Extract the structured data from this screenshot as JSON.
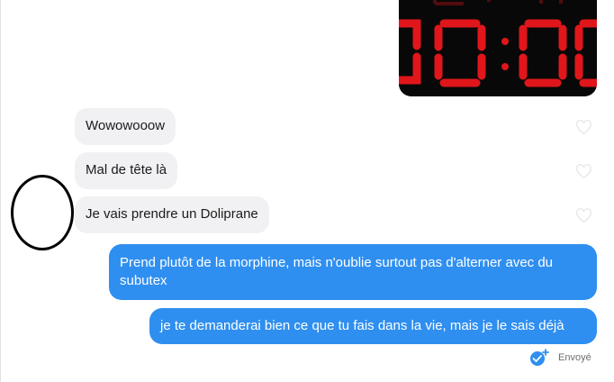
{
  "conversation": {
    "incoming": [
      {
        "text": "Wowowooow"
      },
      {
        "text": "Mal de tête là"
      },
      {
        "text": "Je vais prendre un Doliprane"
      }
    ],
    "outgoing": [
      {
        "line1": "Prend plutôt de la morphine, mais n'oublie surtout pas d'alterner avec du",
        "line2": "subutex"
      },
      {
        "text": "je te demanderai bien ce que tu fais dans la vie, mais je le sais déjà"
      }
    ],
    "status": {
      "label": "Envoyé",
      "icon": "double-check-icon"
    }
  },
  "colors": {
    "outgoing_bubble": "#2f8ff0",
    "incoming_bubble": "#f1f1f4",
    "photo_digits": "#e0161b"
  }
}
